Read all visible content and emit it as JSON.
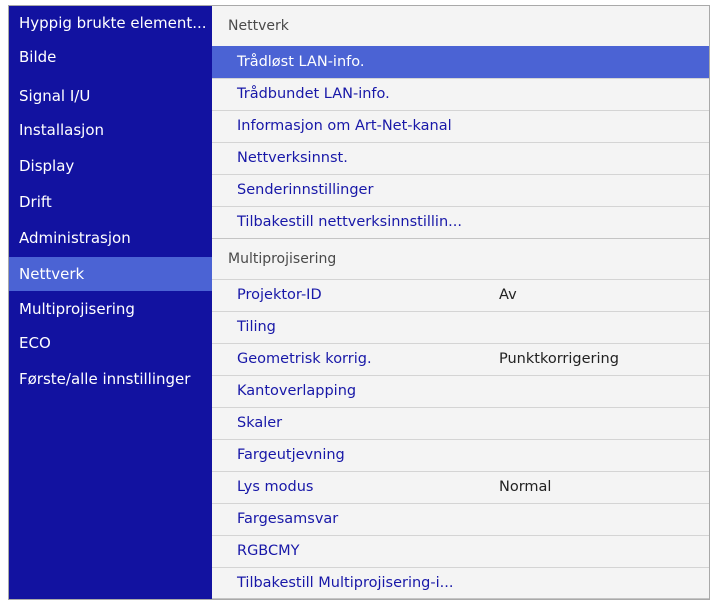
{
  "sidebar": {
    "items": [
      {
        "label": "Hyppig brukte element..."
      },
      {
        "label": "Bilde"
      },
      {
        "label": "Signal I/U"
      },
      {
        "label": "Installasjon"
      },
      {
        "label": "Display"
      },
      {
        "label": "Drift"
      },
      {
        "label": "Administrasjon"
      },
      {
        "label": "Nettverk"
      },
      {
        "label": "Multiprojisering"
      },
      {
        "label": "ECO"
      },
      {
        "label": "Første/alle innstillinger"
      }
    ],
    "active": "Nettverk"
  },
  "content": {
    "sections": [
      {
        "title": "Nettverk",
        "rows": [
          {
            "label": "Trådløst LAN-info.",
            "value": "",
            "selected": true
          },
          {
            "label": "Trådbundet LAN-info.",
            "value": ""
          },
          {
            "label": "Informasjon om Art-Net-kanal",
            "value": ""
          },
          {
            "label": "Nettverksinnst.",
            "value": ""
          },
          {
            "label": "Senderinnstillinger",
            "value": ""
          },
          {
            "label": "Tilbakestill nettverksinnstillin...",
            "value": ""
          }
        ]
      },
      {
        "title": "Multiprojisering",
        "rows": [
          {
            "label": "Projektor-ID",
            "value": "Av"
          },
          {
            "label": "Tiling",
            "value": ""
          },
          {
            "label": "Geometrisk korrig.",
            "value": "Punktkorrigering"
          },
          {
            "label": "Kantoverlapping",
            "value": ""
          },
          {
            "label": "Skaler",
            "value": ""
          },
          {
            "label": "Fargeutjevning",
            "value": ""
          },
          {
            "label": "Lys modus",
            "value": "Normal"
          },
          {
            "label": "Fargesamsvar",
            "value": ""
          },
          {
            "label": "RGBCMY",
            "value": ""
          },
          {
            "label": "Tilbakestill Multiprojisering-i...",
            "value": ""
          }
        ]
      }
    ]
  },
  "colors": {
    "sidebar_bg": "#1212a0",
    "highlight": "#4b63d4",
    "item_text": "#1818a8",
    "panel_bg": "#f4f4f4"
  }
}
